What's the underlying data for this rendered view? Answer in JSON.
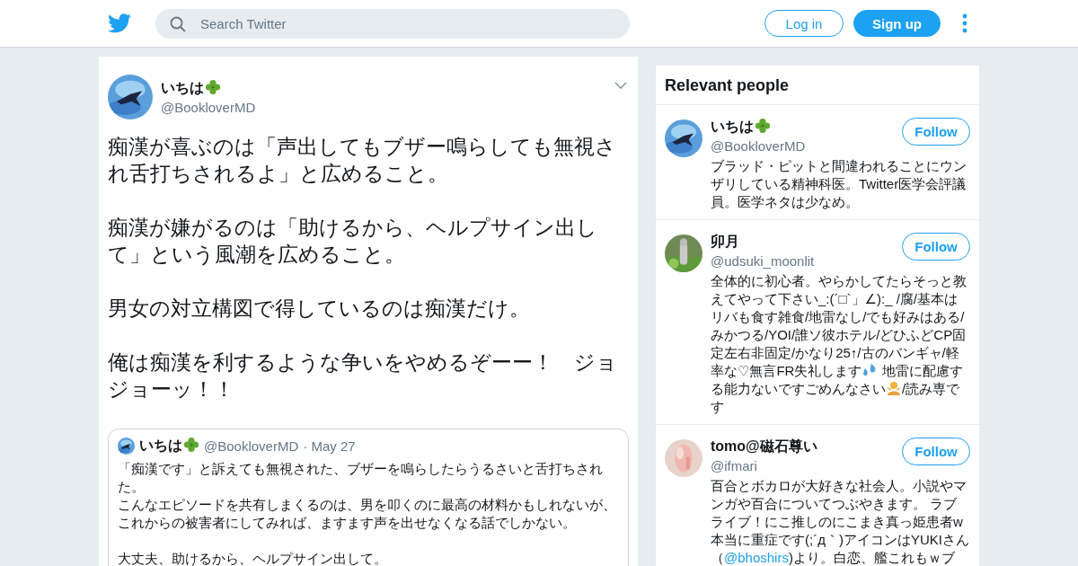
{
  "header": {
    "search": {
      "placeholder": "Search Twitter"
    },
    "buttons": [
      {
        "label": "Log in",
        "kind": "outline"
      },
      {
        "label": "Sign up",
        "kind": "filled"
      }
    ]
  },
  "tweet": {
    "name": "いちは",
    "clover": true,
    "handle": "@BookloverMD",
    "paragraphs": [
      "痴漢が喜ぶのは「声出してもブザー鳴らしても無視され舌打ちされるよ」と広めること。",
      "痴漢が嫌がるのは「助けるから、ヘルプサイン出して」という風潮を広めること。",
      "男女の対立構図で得しているのは痴漢だけ。",
      "俺は痴漢を利するような争いをやめるぞーー！　ジョジョーッ！！"
    ],
    "quote": {
      "name": "いちは",
      "clover": true,
      "handle": "@BookloverMD",
      "date": "· May 27",
      "paragraphs": [
        [
          "「痴漢です」と訴えても無視された、ブザーを鳴らしたらうるさいと舌打ちされた。",
          "こんなエピソードを共有しまくるのは、男を叩くのに最高の材料かもしれないが、",
          "これからの被害者にしてみれば、ますます声を出せなくなる話でしかない。"
        ],
        [
          "大丈夫、助けるから、ヘルプサイン出して。"
        ]
      ]
    }
  },
  "sidebar": {
    "title": "Relevant people",
    "people": [
      {
        "name": "いちは",
        "clover": true,
        "handle": "@BookloverMD",
        "follow": "Follow",
        "bio": [
          {
            "kind": "text",
            "text": "ブラッド・ピットと間違われることにウンザリしている精神科医。Twitter医学会評議員。医学ネタは少なめ。"
          }
        ]
      },
      {
        "name": "卯月",
        "clover": false,
        "handle": "@udsuki_moonlit",
        "follow": "Follow",
        "bio": [
          {
            "kind": "text",
            "text": "全体的に初心者。やらかしてたらそっと教えてやって下さい_:(´□`」∠):_ /腐/基本はリバも食す雑食/地雷なし/でも好みはある/みかつる/YOI/誰ソ彼ホテル/どひふどCP固定左右非固定/かなり25↑/古のバンギャ/軽率な♡無言FR失礼します"
          },
          {
            "kind": "droplets"
          },
          {
            "kind": "text",
            "text": " 地雷に配慮する能力ないですごめんなさい"
          },
          {
            "kind": "person"
          },
          {
            "kind": "text",
            "text": "/読み専です"
          }
        ]
      },
      {
        "name": "tomo@磁石尊い",
        "clover": false,
        "handle": "@ifmari",
        "follow": "Follow",
        "bio": [
          {
            "kind": "text",
            "text": "百合とボカロが大好きな社会人。小説やマンガや百合についてつぶやきます。 ラブライブ！にこ推しのにこまき真っ姫患者w本当に重症です(;´д｀)アイコンはYUKIさん（"
          },
          {
            "kind": "link",
            "text": "@bhoshirs"
          },
          {
            "kind": "text",
            "text": ")より。白恋、艦これもｗブ"
          }
        ]
      }
    ]
  }
}
